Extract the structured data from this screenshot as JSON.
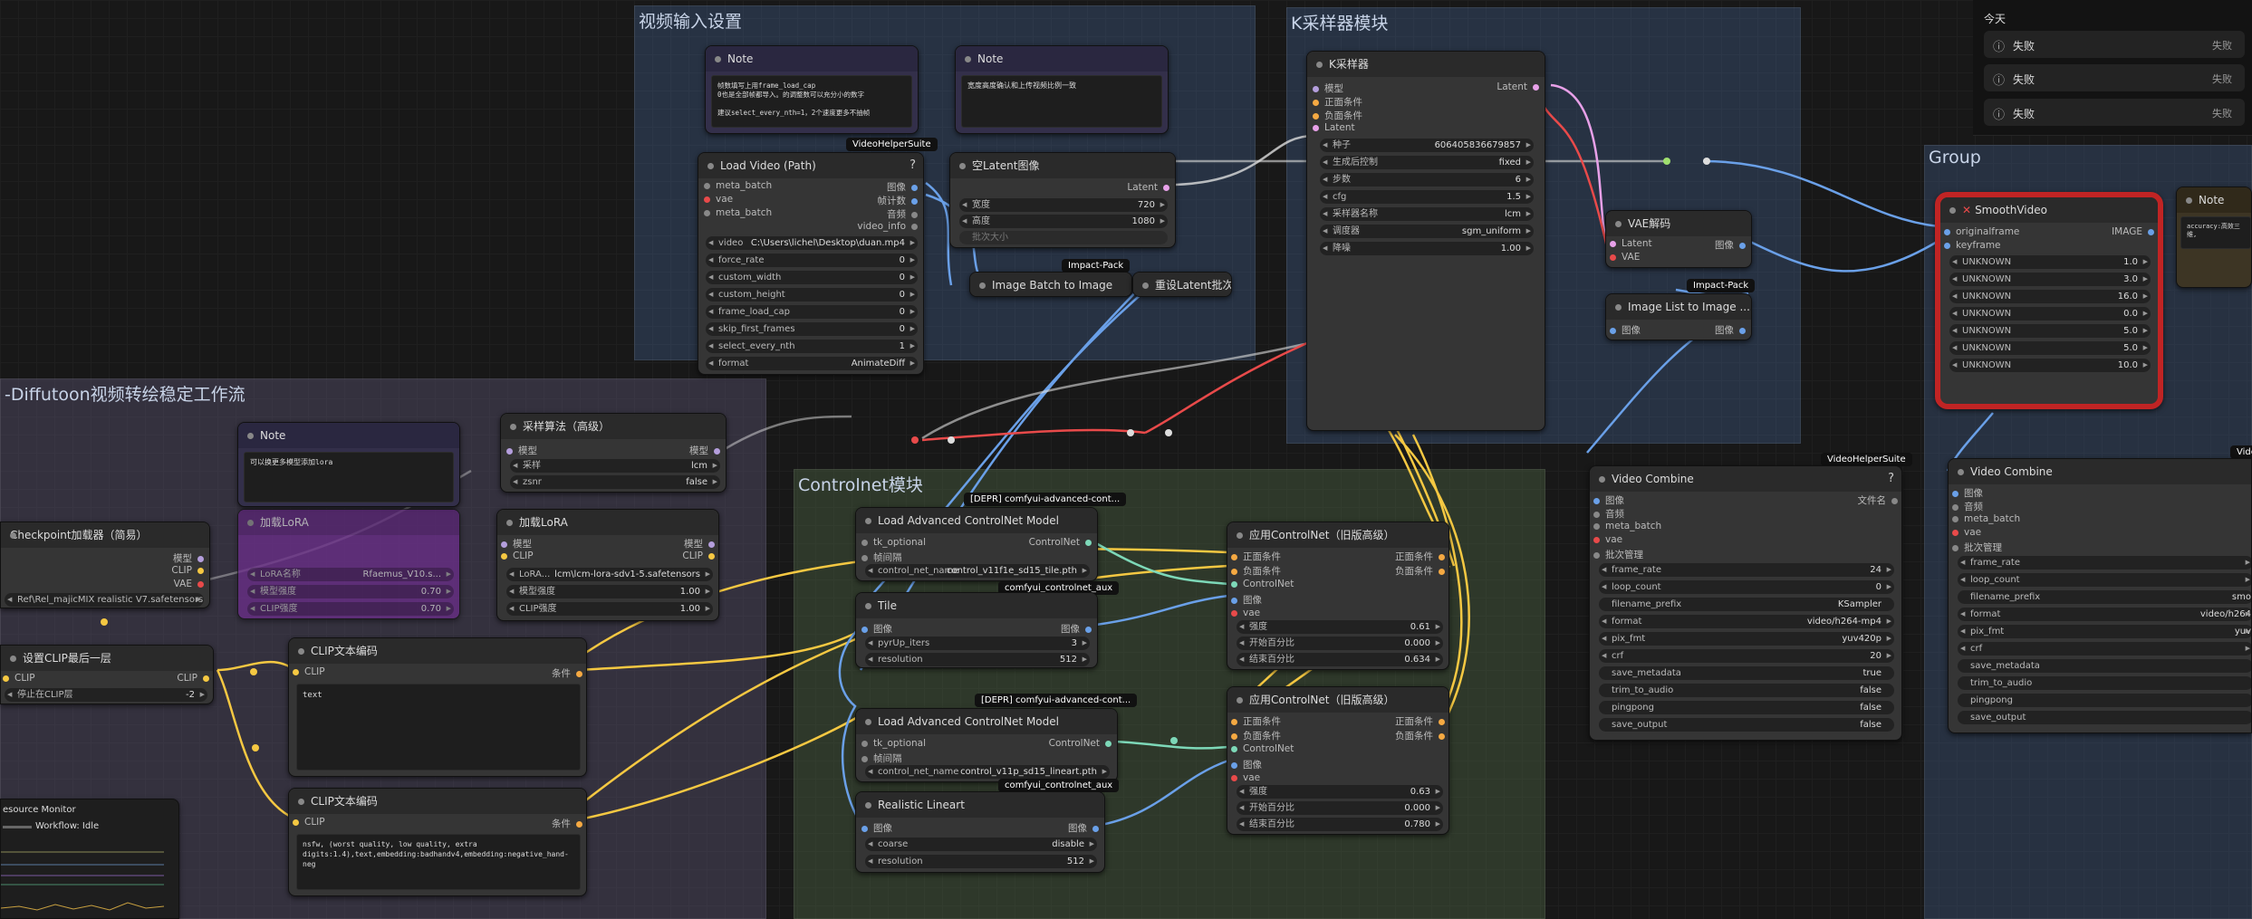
{
  "groups": {
    "video_input": "视频输入设置",
    "ksampler": "K采样器模块",
    "diffutoon": "-Diffutoon视频转绘稳定工作流",
    "controlnet": "Controlnet模块",
    "group": "Group"
  },
  "history": {
    "today": "今天",
    "items": [
      {
        "name": "失败",
        "status": "失败"
      },
      {
        "name": "失败",
        "status": "失败"
      },
      {
        "name": "失败",
        "status": "失败"
      }
    ]
  },
  "badges": {
    "vhs": "VideoHelperSuite",
    "impact1": "Impact-Pack",
    "impact2": "Impact-Pack",
    "vhs2": "VideoHelperSuite",
    "vhs3": "Video",
    "depr1": "[DEPR] comfyui-advanced-cont...",
    "depr2": "[DEPR] comfyui-advanced-cont...",
    "aux1": "comfyui_controlnet_aux",
    "aux2": "comfyui_controlnet_aux"
  },
  "note1": {
    "title": "Note",
    "text": "帧数填写上用frame_load_cap\n0也是全部帧都导入。的调整数可以充分小的数字\n\n建议select_every_nth=1，2个速度更多不抽帧"
  },
  "note2": {
    "title": "Note",
    "text": "宽度高度确认和上传视频比例一致"
  },
  "note3": {
    "title": "Note",
    "text": "可以换更多模型添加lora"
  },
  "note4": {
    "title": "Note",
    "text": "accuracy:高效三维,"
  },
  "load_video": {
    "title": "Load Video (Path)",
    "in": [
      "meta_batch",
      "vae",
      "meta_batch"
    ],
    "out": [
      "图像",
      "帧计数",
      "音频",
      "video_info"
    ],
    "widgets": [
      {
        "l": "video",
        "v": "C:\\Users\\lichel\\Desktop\\duan.mp4"
      },
      {
        "l": "force_rate",
        "v": "0"
      },
      {
        "l": "custom_width",
        "v": "0"
      },
      {
        "l": "custom_height",
        "v": "0"
      },
      {
        "l": "frame_load_cap",
        "v": "0"
      },
      {
        "l": "skip_first_frames",
        "v": "0"
      },
      {
        "l": "select_every_nth",
        "v": "1"
      },
      {
        "l": "format",
        "v": "AnimateDiff"
      }
    ]
  },
  "empty_latent": {
    "title": "空Latent图像",
    "out": "Latent",
    "widgets": [
      {
        "l": "宽度",
        "v": "720"
      },
      {
        "l": "高度",
        "v": "1080"
      },
      {
        "l": "批次大小",
        "v": ""
      }
    ]
  },
  "image_batch": {
    "title": "Image Batch to Image"
  },
  "repeat_latent": {
    "title": "重设Latent批次"
  },
  "ksampler": {
    "title": "K采样器",
    "in": [
      "模型",
      "正面条件",
      "负面条件",
      "Latent"
    ],
    "out": "Latent",
    "widgets": [
      {
        "l": "种子",
        "v": "606405836679857"
      },
      {
        "l": "生成后控制",
        "v": "fixed"
      },
      {
        "l": "步数",
        "v": "6"
      },
      {
        "l": "cfg",
        "v": "1.5"
      },
      {
        "l": "采样器名称",
        "v": "lcm"
      },
      {
        "l": "调度器",
        "v": "sgm_uniform"
      },
      {
        "l": "降噪",
        "v": "1.00"
      }
    ]
  },
  "vae_decode": {
    "title": "VAE解码",
    "in": [
      "Latent",
      "VAE"
    ],
    "out": "图像"
  },
  "image_list": {
    "title": "Image List to Image ...",
    "in": "图像",
    "out": "图像"
  },
  "smooth": {
    "title": "SmoothVideo",
    "in": [
      "originalframe",
      "keyframe"
    ],
    "out": "IMAGE",
    "widgets": [
      {
        "l": "UNKNOWN",
        "v": "1.0"
      },
      {
        "l": "UNKNOWN",
        "v": "3.0"
      },
      {
        "l": "UNKNOWN",
        "v": "16.0"
      },
      {
        "l": "UNKNOWN",
        "v": "0.0"
      },
      {
        "l": "UNKNOWN",
        "v": "5.0"
      },
      {
        "l": "UNKNOWN",
        "v": "5.0"
      },
      {
        "l": "UNKNOWN",
        "v": "10.0"
      }
    ]
  },
  "note_top": {
    "title": "Note"
  },
  "sampling": {
    "title": "采样算法（高级）",
    "in": "模型",
    "out": "模型",
    "widgets": [
      {
        "l": "采样",
        "v": "lcm"
      },
      {
        "l": "zsnr",
        "v": "false"
      }
    ]
  },
  "checkpoint": {
    "title": "Checkpoint加载器（简易）",
    "out": [
      "模型",
      "CLIP",
      "VAE"
    ],
    "widget": "Ref\\Rel_majicMIX realistic V7.safetensors"
  },
  "lora_disabled": {
    "title": "加载LoRA",
    "widgets": [
      {
        "l": "LoRA名称",
        "v": "Rfaemus_V10.s..."
      },
      {
        "l": "模型强度",
        "v": "0.70"
      },
      {
        "l": "CLIP强度",
        "v": "0.70"
      }
    ]
  },
  "lora": {
    "title": "加载LoRA",
    "in": [
      "模型",
      "CLIP"
    ],
    "out": [
      "模型",
      "CLIP"
    ],
    "widgets": [
      {
        "l": "LoRA...",
        "v": "lcm\\lcm-lora-sdv1-5.safetensors"
      },
      {
        "l": "模型强度",
        "v": "1.00"
      },
      {
        "l": "CLIP强度",
        "v": "1.00"
      }
    ]
  },
  "clip_last": {
    "title": "设置CLIP最后一层",
    "in": "CLIP",
    "out": "CLIP",
    "widget": {
      "l": "停止在CLIP层",
      "v": "-2"
    }
  },
  "clip1": {
    "title": "CLIP文本编码",
    "in": "CLIP",
    "out": "条件",
    "text": "text"
  },
  "clip2": {
    "title": "CLIP文本编码",
    "in": "CLIP",
    "out": "条件",
    "text": "nsfw, (worst quality, low quality, extra digits:1.4),text,embedding:badhandv4,embedding:negative_hand-neg"
  },
  "resmon": {
    "title": "esource Monitor",
    "status": "Workflow: Idle"
  },
  "acn1": {
    "title": "Load Advanced ControlNet Model",
    "in": [
      "tk_optional",
      "帧间隔"
    ],
    "out": "ControlNet",
    "widget": {
      "l": "control_net_name",
      "v": "control_v11f1e_sd15_tile.pth"
    }
  },
  "tile": {
    "title": "Tile",
    "in": "图像",
    "out": "图像",
    "widgets": [
      {
        "l": "pyrUp_iters",
        "v": "3"
      },
      {
        "l": "resolution",
        "v": "512"
      }
    ]
  },
  "acn2": {
    "title": "Load Advanced ControlNet Model",
    "in": [
      "tk_optional",
      "帧间隔"
    ],
    "out": "ControlNet",
    "widget": {
      "l": "control_net_name",
      "v": "control_v11p_sd15_lineart.pth"
    }
  },
  "lineart": {
    "title": "Realistic Lineart",
    "in": "图像",
    "out": "图像",
    "widgets": [
      {
        "l": "coarse",
        "v": "disable"
      },
      {
        "l": "resolution",
        "v": "512"
      }
    ]
  },
  "apply1": {
    "title": "应用ControlNet（旧版高级）",
    "in": [
      "正面条件",
      "负面条件",
      "ControlNet",
      "图像",
      "vae"
    ],
    "out": [
      "正面条件",
      "负面条件"
    ],
    "widgets": [
      {
        "l": "强度",
        "v": "0.61"
      },
      {
        "l": "开始百分比",
        "v": "0.000"
      },
      {
        "l": "结束百分比",
        "v": "0.634"
      }
    ]
  },
  "apply2": {
    "title": "应用ControlNet（旧版高级）",
    "in": [
      "正面条件",
      "负面条件",
      "ControlNet",
      "图像",
      "vae"
    ],
    "out": [
      "正面条件",
      "负面条件"
    ],
    "widgets": [
      {
        "l": "强度",
        "v": "0.63"
      },
      {
        "l": "开始百分比",
        "v": "0.000"
      },
      {
        "l": "结束百分比",
        "v": "0.780"
      }
    ]
  },
  "combine1": {
    "title": "Video Combine",
    "in": [
      "图像",
      "音频",
      "meta_batch",
      "vae",
      "批次管理"
    ],
    "out": "文件名",
    "widgets": [
      {
        "l": "frame_rate",
        "v": "24"
      },
      {
        "l": "loop_count",
        "v": "0"
      },
      {
        "l": "filename_prefix",
        "v": "KSampler"
      },
      {
        "l": "format",
        "v": "video/h264-mp4"
      },
      {
        "l": "pix_fmt",
        "v": "yuv420p"
      },
      {
        "l": "crf",
        "v": "20"
      },
      {
        "l": "save_metadata",
        "v": "true"
      },
      {
        "l": "trim_to_audio",
        "v": "false"
      },
      {
        "l": "pingpong",
        "v": "false"
      },
      {
        "l": "save_output",
        "v": "false"
      }
    ]
  },
  "combine2": {
    "title": "Video Combine",
    "in": [
      "图像",
      "音频",
      "meta_batch",
      "vae",
      "批次管理"
    ],
    "widgets": [
      {
        "l": "frame_rate",
        "v": ""
      },
      {
        "l": "loop_count",
        "v": ""
      },
      {
        "l": "filename_prefix",
        "v": "smo"
      },
      {
        "l": "format",
        "v": "video/h264"
      },
      {
        "l": "pix_fmt",
        "v": "yuv"
      },
      {
        "l": "crf",
        "v": ""
      },
      {
        "l": "save_metadata",
        "v": ""
      },
      {
        "l": "trim_to_audio",
        "v": ""
      },
      {
        "l": "pingpong",
        "v": ""
      },
      {
        "l": "save_output",
        "v": ""
      }
    ]
  }
}
